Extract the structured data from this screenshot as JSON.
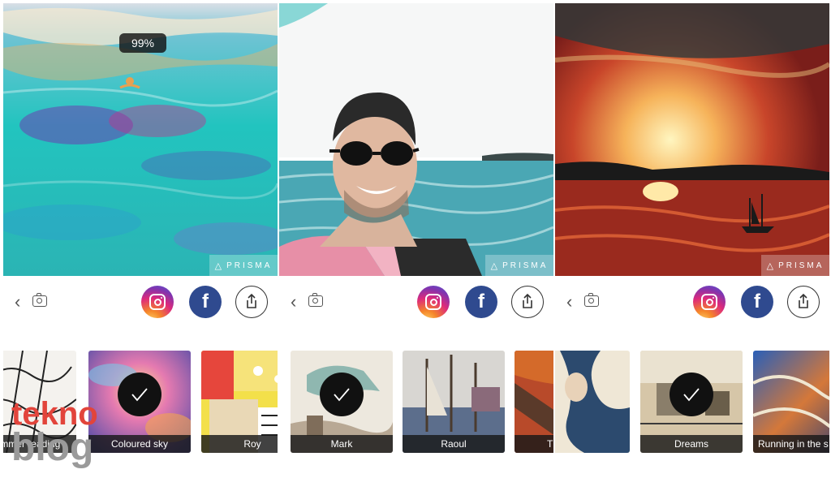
{
  "watermark": {
    "top": "tekno",
    "bottom": "blog"
  },
  "panels": [
    {
      "progress": "99%",
      "badge": "PRISMA",
      "filters": [
        "summer reading",
        "Coloured sky",
        "Roy"
      ],
      "selected": "Coloured sky"
    },
    {
      "badge": "PRISMA",
      "filters": [
        "Mark",
        "Raoul",
        "Thus D - Lone Wolf"
      ],
      "selected": "Mark"
    },
    {
      "badge": "PRISMA",
      "filters": [
        "Dreams",
        "Running in the s"
      ],
      "selected": "Dreams"
    }
  ],
  "icons": [
    "back-chevron-icon",
    "camera-icon",
    "instagram-icon",
    "facebook-icon",
    "share-icon",
    "checkmark-icon",
    "prisma-triangle-icon"
  ]
}
